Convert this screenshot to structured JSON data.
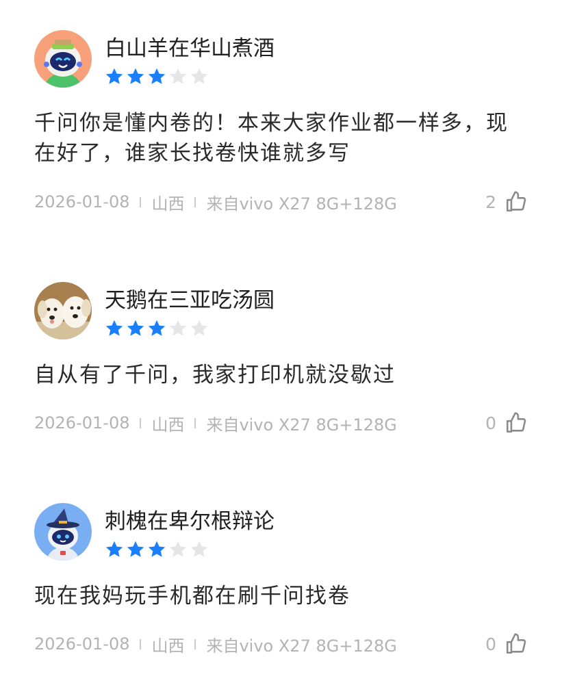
{
  "colors": {
    "star_filled": "#1a7fff",
    "star_empty": "#e6e6e6",
    "meta_text": "#b3b3b3",
    "body_text": "#2a2a2a"
  },
  "reviews": [
    {
      "avatar_icon": "robot-mascot-green-hat-avatar",
      "username": "白山羊在华山煮酒",
      "rating": 3,
      "rating_max": 5,
      "content": "千问你是懂内卷的！本来大家作业都一样多，现在好了，谁家长找卷快谁就多写",
      "date": "2026-01-08",
      "location": "山西",
      "device": "来自vivo X27 8G+128G",
      "likes": "2"
    },
    {
      "avatar_icon": "two-puppies-photo-avatar",
      "username": "天鹅在三亚吃汤圆",
      "rating": 3,
      "rating_max": 5,
      "content": "自从有了千问，我家打印机就没歇过",
      "date": "2026-01-08",
      "location": "山西",
      "device": "来自vivo X27 8G+128G",
      "likes": "0"
    },
    {
      "avatar_icon": "robot-mascot-wizard-hat-avatar",
      "username": "刺槐在卑尔根辩论",
      "rating": 3,
      "rating_max": 5,
      "content": "现在我妈玩手机都在刷千问找卷",
      "date": "2026-01-08",
      "location": "山西",
      "device": "来自vivo X27 8G+128G",
      "likes": "0"
    }
  ]
}
